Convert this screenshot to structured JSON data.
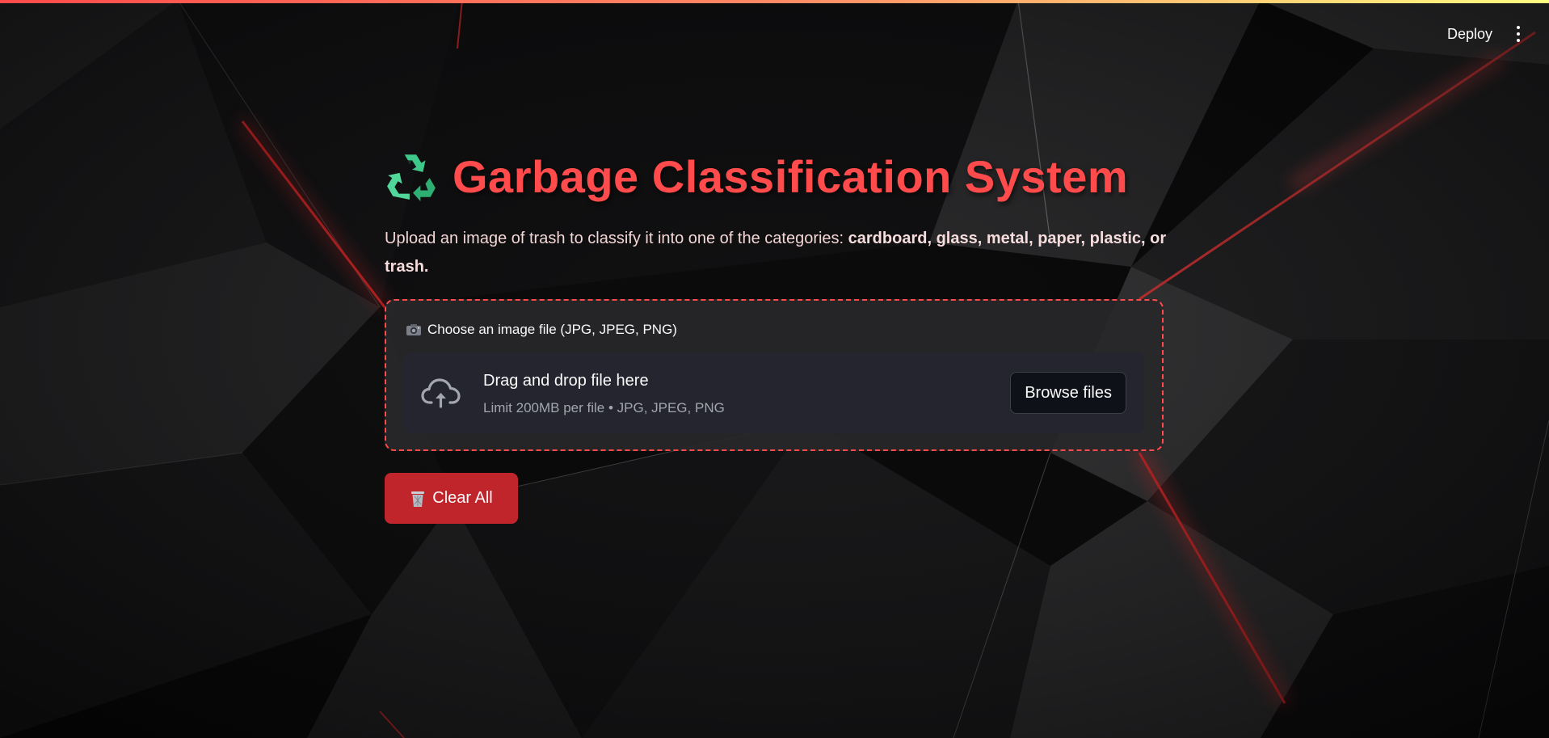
{
  "header": {
    "deploy_label": "Deploy",
    "menu_icon": "more-vertical-icon"
  },
  "main": {
    "title_icon": "recycle-icon",
    "title": "Garbage Classification System",
    "subtitle_prefix": "Upload an image of trash to classify it into one of the categories: ",
    "subtitle_categories": "cardboard, glass, metal, paper, plastic, or trash."
  },
  "uploader": {
    "label_icon": "camera-icon",
    "label": "Choose an image file (JPG, JPEG, PNG)",
    "drop_icon": "cloud-upload-icon",
    "drop_title": "Drag and drop file here",
    "drop_hint": "Limit 200MB per file • JPG, JPEG, PNG",
    "browse_label": "Browse files"
  },
  "actions": {
    "clear_icon": "trash-icon",
    "clear_label": "Clear All"
  },
  "colors": {
    "accent": "#ff4b4b",
    "clear_button": "#c0252c",
    "recycle_green": "#3ec98a"
  }
}
